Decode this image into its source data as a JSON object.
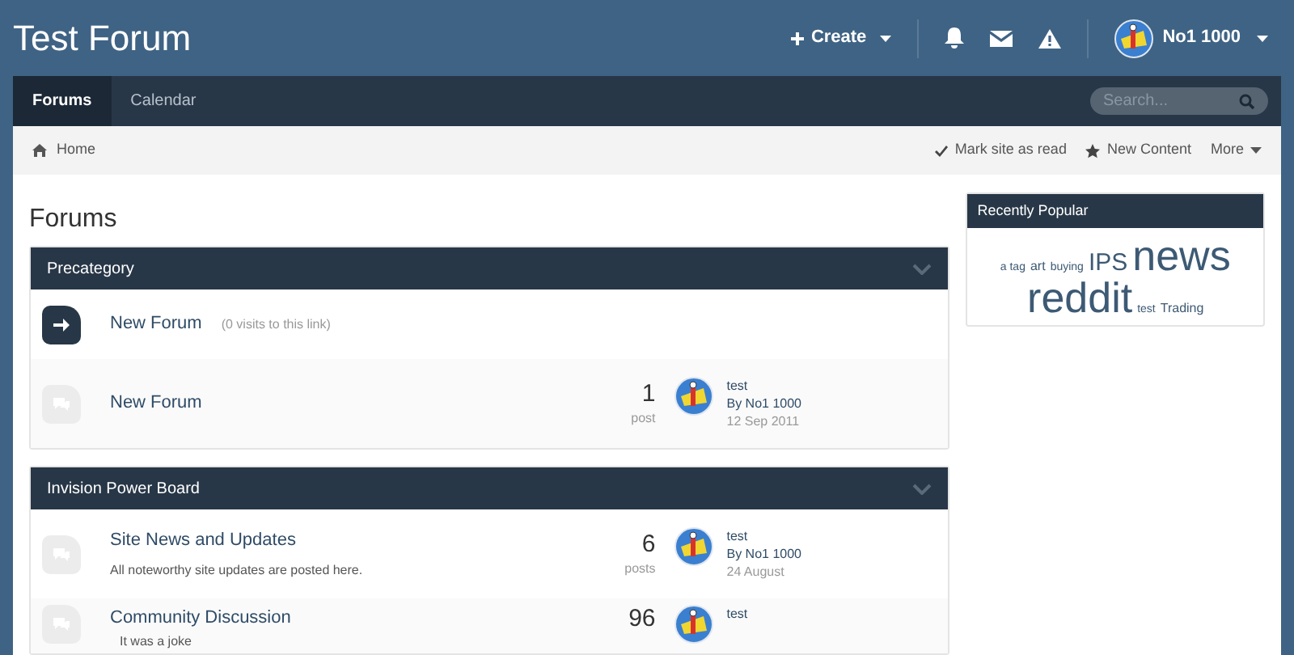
{
  "site_title": "Test Forum",
  "header_actions": {
    "create": "Create",
    "user": "No1 1000"
  },
  "nav_tabs": [
    {
      "label": "Forums",
      "selected": true
    },
    {
      "label": "Calendar",
      "selected": false
    }
  ],
  "search": {
    "placeholder": "Search..."
  },
  "breadcrumb": [
    "Home"
  ],
  "page_actions": [
    "Mark site as read",
    "New Content",
    "More"
  ],
  "page_title": "Forums",
  "categories": [
    {
      "title": "Precategory",
      "forums": [
        {
          "kind": "redirect",
          "name": "New Forum",
          "note": "(0 visits to this link)"
        },
        {
          "kind": "forum",
          "name": "New Forum",
          "count": "1",
          "count_label": "post",
          "last_title": "test",
          "last_by": "By No1 1000",
          "last_date": "12 Sep 2011"
        }
      ]
    },
    {
      "title": "Invision Power Board",
      "forums": [
        {
          "kind": "forum",
          "name": "Site News and Updates",
          "description": "All noteworthy site updates are posted here.",
          "count": "6",
          "count_label": "posts",
          "last_title": "test",
          "last_by": "By No1 1000",
          "last_date": "24 August"
        },
        {
          "kind": "forum",
          "name": "Community Discussion",
          "subforum": "It was a joke",
          "count": "96",
          "last_title": "test"
        }
      ]
    }
  ],
  "sidebar": {
    "title": "Recently Popular",
    "tags": [
      {
        "label": "a tag",
        "kind": "small"
      },
      {
        "label": "art",
        "kind": "medium"
      },
      {
        "label": "buying",
        "kind": "small"
      },
      {
        "label": "IPS",
        "kind": "large"
      },
      {
        "label": "news",
        "kind": "huge"
      },
      {
        "label": "reddit",
        "kind": "huge"
      },
      {
        "label": "test",
        "kind": "small"
      },
      {
        "label": "Trading",
        "kind": "medium"
      }
    ]
  }
}
